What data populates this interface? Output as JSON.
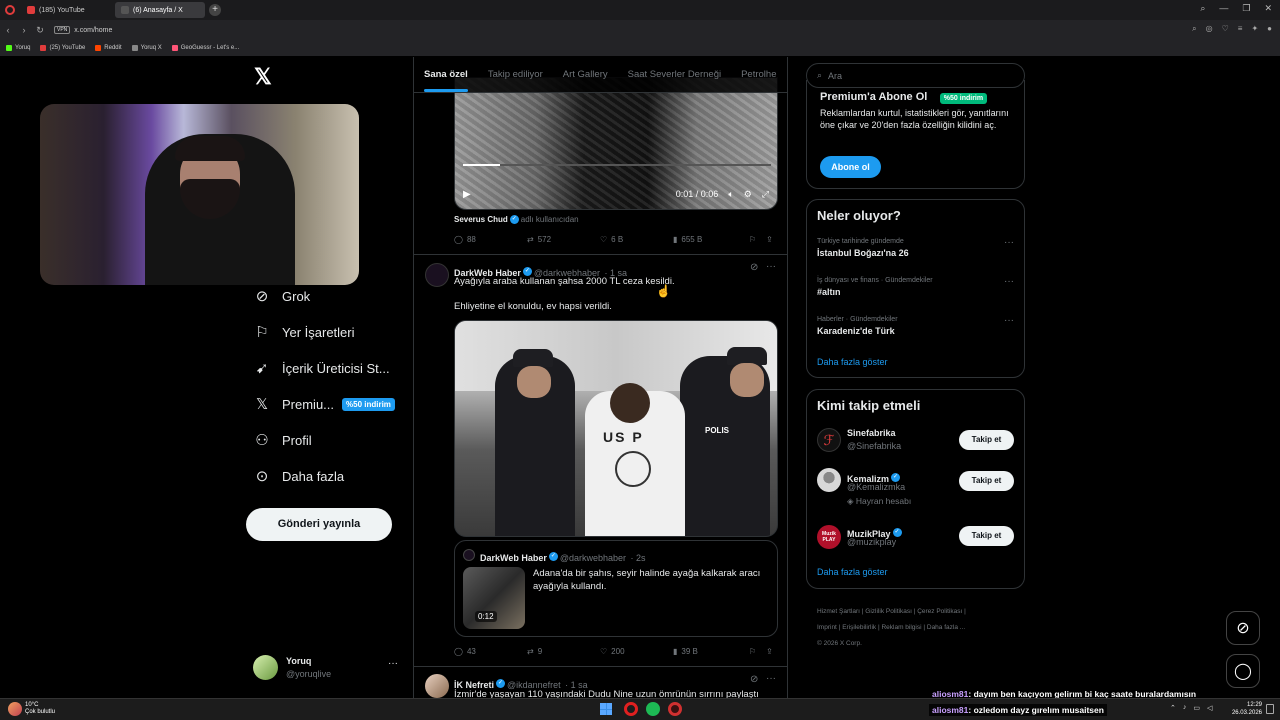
{
  "browser": {
    "tabs": [
      {
        "label": "(185) YouTube",
        "color": "#e03c3c"
      },
      {
        "label": "(6) Anasayfa / X",
        "color": "#555555"
      }
    ],
    "new_tab": "+",
    "vpn": "VPN",
    "url": "x.com/home",
    "bookmarks": [
      {
        "label": "Yoruq",
        "color": "#53fc18"
      },
      {
        "label": "(25) YouTube",
        "color": "#e03c3c"
      },
      {
        "label": "Reddit",
        "color": "#ff4500"
      },
      {
        "label": "Yoruq X",
        "color": "#888888"
      },
      {
        "label": "GeoGuessr - Let's e...",
        "color": "#ff5577"
      }
    ]
  },
  "left_nav": {
    "items": [
      {
        "label": "Grok",
        "icon": "grok-icon"
      },
      {
        "label": "Yer İşaretleri",
        "icon": "bookmark-icon"
      },
      {
        "label": "İçerik Üreticisi St...",
        "icon": "rocket-icon"
      },
      {
        "label": "Premiu...",
        "icon": "x-premium-icon",
        "badge": "%50 indirim"
      },
      {
        "label": "Profil",
        "icon": "person-icon"
      },
      {
        "label": "Daha fazla",
        "icon": "more-circle-icon"
      }
    ],
    "post_button": "Gönderi yayınla",
    "account": {
      "name": "Yoruq",
      "handle": "@yoruqlive"
    }
  },
  "feed_tabs": [
    "Sana özel",
    "Takip ediliyor",
    "Art Gallery",
    "Saat Severler Derneği",
    "Petrolhe"
  ],
  "tweets": {
    "first": {
      "time": "0:01 / 0:06",
      "attribution_name": "Severus Chud",
      "attribution_suffix": "adlı kullanıcıdan",
      "replies": "88",
      "reposts": "572",
      "likes": "6 B",
      "views": "655 B"
    },
    "second": {
      "name": "DarkWeb Haber",
      "handle": "@darkwebhaber",
      "time": "· 1 sa",
      "text1": "Ayağıyla araba kullanan şahsa 2000 TL ceza kesildi.",
      "text2": "Ehliyetine el konuldu, ev hapsi verildi.",
      "shirt_text": "US P",
      "police_label": "POLIS",
      "quote": {
        "name": "DarkWeb Haber",
        "handle": "@darkwebhaber",
        "time": "· 2s",
        "text": "Adana'da bir şahıs, seyir halinde ayağa kalkarak aracı ayağıyla kullandı.",
        "duration": "0:12"
      },
      "replies": "43",
      "reposts": "9",
      "likes": "200",
      "views": "39 B"
    },
    "third": {
      "name": "İK Nefreti",
      "handle": "@ikdannefret",
      "time": "· 1 sa",
      "text": "İzmir'de yaşayan 110 yaşındaki Dudu Nine uzun ömrünün sırrını paylaştı"
    }
  },
  "right": {
    "search_placeholder": "Ara",
    "premium": {
      "title": "Premium'a Abone Ol",
      "badge": "%50 indirim",
      "text": "Reklamlardan kurtul, istatistikleri gör, yanıtlarını öne çıkar ve 20'den fazla özelliğin kilidini aç.",
      "button": "Abone ol"
    },
    "trends": {
      "title": "Neler oluyor?",
      "items": [
        {
          "meta": "Türkiye tarihinde gündemde",
          "title": "İstanbul Boğazı'na 26"
        },
        {
          "meta": "İş dünyası ve finans · Gündemdekiler",
          "title": "#altın"
        },
        {
          "meta": "Haberler · Gündemdekiler",
          "title": "Karadeniz'de Türk"
        }
      ],
      "more": "Daha fazla göster"
    },
    "who_to_follow": {
      "title": "Kimi takip etmeli",
      "items": [
        {
          "name": "Sinefabrika",
          "handle": "@Sinefabrika",
          "extra": "",
          "button": "Takip et",
          "avatar_color": "#111111"
        },
        {
          "name": "Kemalizm",
          "handle": "@Kemalizmka",
          "extra": "Hayran hesabı",
          "button": "Takip et",
          "avatar_color": "#d8d8d8"
        },
        {
          "name": "MuzikPlay",
          "handle": "@muzikplay",
          "extra": "",
          "button": "Takip et",
          "avatar_color": "#b0102a",
          "avatar_text": "Muzik PLAY"
        }
      ],
      "more": "Daha fazla göster"
    },
    "footer": [
      "Hizmet Şartları",
      "Gizlilik Politikası",
      "Çerez Politikası",
      "Imprint",
      "Erişilebilirlik",
      "Reklam bilgisi",
      "Daha fazla ...",
      "© 2026 X Corp."
    ]
  },
  "chat": [
    {
      "user": "aliosm81",
      "message": ": dayım ben kaçıyom gelirım bi kaç saate buralardamısın"
    },
    {
      "user": "aliosm81",
      "message": ": ozledom dayz gırelım musaitsen"
    }
  ],
  "taskbar": {
    "weather_temp": "10°C",
    "weather_text": "Çok bulutlu",
    "time": "12:29",
    "date": "26.03.2026"
  }
}
